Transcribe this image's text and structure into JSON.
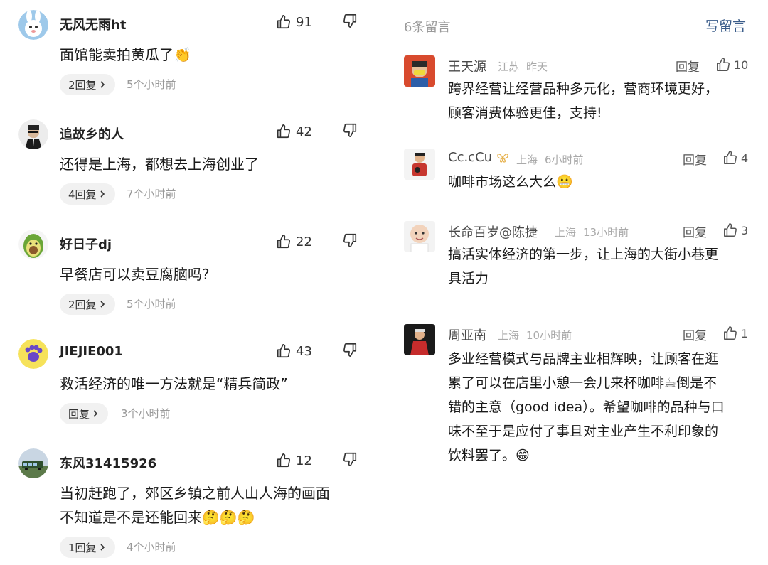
{
  "left_comments": [
    {
      "username": "无风无雨ht",
      "likes": "91",
      "text": "面馆能卖拍黄瓜了",
      "reply_label": "2回复",
      "time": "5个小时前"
    },
    {
      "username": "追故乡的人",
      "likes": "42",
      "text": "还得是上海，都想去上海创业了",
      "reply_label": "4回复",
      "time": "7个小时前"
    },
    {
      "username": "好日子dj",
      "likes": "22",
      "text": "早餐店可以卖豆腐脑吗?",
      "reply_label": "2回复",
      "time": "5个小时前"
    },
    {
      "username": "JIEJIE001",
      "likes": "43",
      "text": "救活经济的唯一方法就是“精兵简政”",
      "reply_label": "回复",
      "time": "3个小时前"
    },
    {
      "username": "东风31415926",
      "likes": "12",
      "text_line1": "当初赶跑了，郊区乡镇之前人山人海的画面",
      "text_line2": "不知道是不是还能回来",
      "reply_label": "1回复",
      "time": "4个小时前"
    }
  ],
  "right_panel": {
    "count_label": "6条留言",
    "write_label": "写留言",
    "comments": [
      {
        "username": "王天源",
        "location": "江苏",
        "time": "昨天",
        "reply": "回复",
        "likes": "10",
        "lines": [
          "跨界经营让经营品种多元化，营商环境更好，",
          "顾客消费体验更佳，支持!"
        ]
      },
      {
        "username": "Cc.cCu",
        "location": "上海",
        "time": "6小时前",
        "reply": "回复",
        "likes": "4",
        "lines": [
          "咖啡市场这么大么"
        ]
      },
      {
        "username": "长命百岁@陈捷",
        "location": "上海",
        "time": "13小时前",
        "reply": "回复",
        "likes": "3",
        "lines": [
          "搞活实体经济的第一步，让上海的大街小巷更",
          "具活力"
        ]
      },
      {
        "username": "周亚南",
        "location": "上海",
        "time": "10小时前",
        "reply": "回复",
        "likes": "1",
        "lines": [
          "多业经营模式与品牌主业相辉映，让顾客在逛",
          "累了可以在店里小憩一会儿来杯咖啡",
          "错的主意（good idea）。希望咖啡的品种与口",
          "味不至于是应付了事且对主业产生不利印象的",
          "饮料罢了。"
        ],
        "line2_tail": "倒是不"
      }
    ]
  }
}
